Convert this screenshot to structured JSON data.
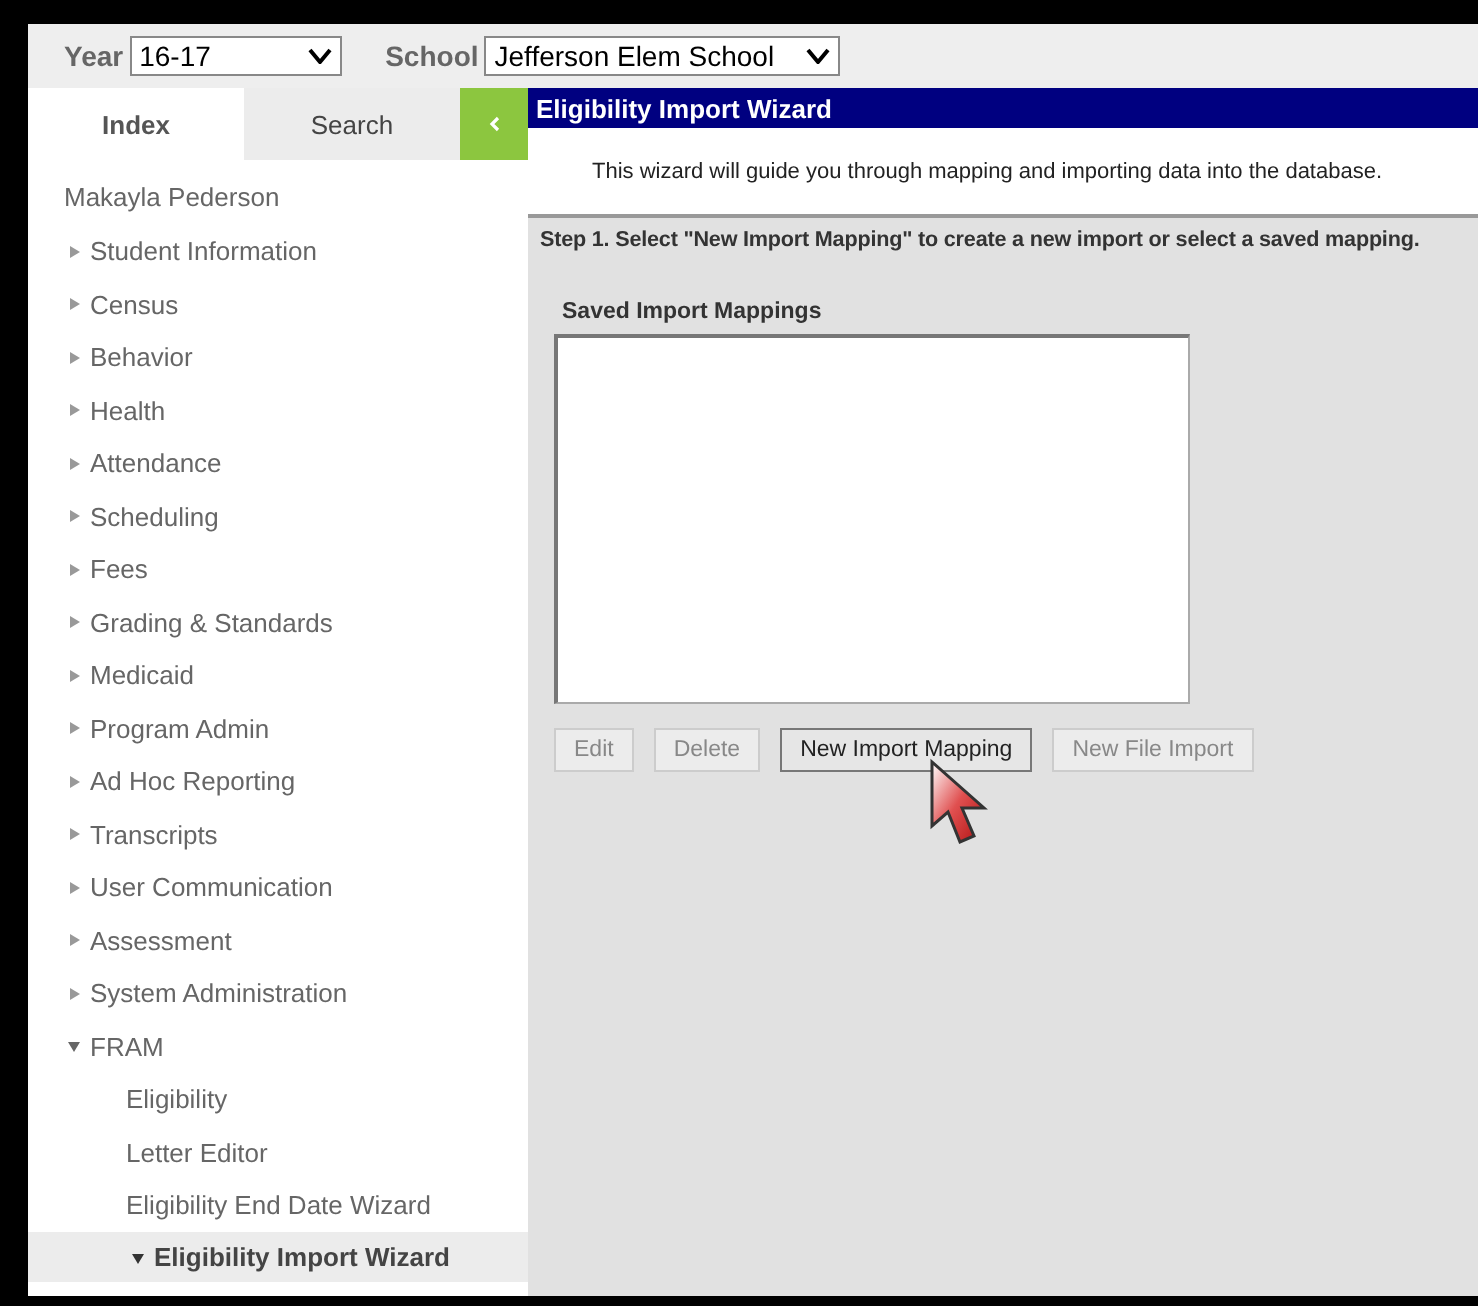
{
  "toolbar": {
    "year": {
      "label": "Year",
      "value": "16-17"
    },
    "school": {
      "label": "School",
      "value": "Jefferson Elem School"
    }
  },
  "tabs": [
    {
      "label": "Index",
      "selected": true
    },
    {
      "label": "Search",
      "selected": false
    }
  ],
  "sidebar": {
    "person": "Makayla Pederson",
    "items": [
      {
        "label": "Student Information",
        "kind": "folder",
        "expanded": false,
        "selected": false
      },
      {
        "label": "Census",
        "kind": "folder",
        "expanded": false,
        "selected": false
      },
      {
        "label": "Behavior",
        "kind": "folder",
        "expanded": false,
        "selected": false
      },
      {
        "label": "Health",
        "kind": "folder",
        "expanded": false,
        "selected": false
      },
      {
        "label": "Attendance",
        "kind": "folder",
        "expanded": false,
        "selected": false
      },
      {
        "label": "Scheduling",
        "kind": "folder",
        "expanded": false,
        "selected": false
      },
      {
        "label": "Fees",
        "kind": "folder",
        "expanded": false,
        "selected": false
      },
      {
        "label": "Grading & Standards",
        "kind": "folder",
        "expanded": false,
        "selected": false
      },
      {
        "label": "Medicaid",
        "kind": "folder",
        "expanded": false,
        "selected": false
      },
      {
        "label": "Program Admin",
        "kind": "folder",
        "expanded": false,
        "selected": false
      },
      {
        "label": "Ad Hoc Reporting",
        "kind": "folder",
        "expanded": false,
        "selected": false
      },
      {
        "label": "Transcripts",
        "kind": "folder",
        "expanded": false,
        "selected": false
      },
      {
        "label": "User Communication",
        "kind": "folder",
        "expanded": false,
        "selected": false
      },
      {
        "label": "Assessment",
        "kind": "folder",
        "expanded": false,
        "selected": false
      },
      {
        "label": "System Administration",
        "kind": "folder",
        "expanded": false,
        "selected": false
      },
      {
        "label": "FRAM",
        "kind": "folder",
        "expanded": true,
        "selected": false,
        "children": [
          {
            "label": "Eligibility",
            "kind": "leaf",
            "selected": false
          },
          {
            "label": "Letter Editor",
            "kind": "leaf",
            "selected": false
          },
          {
            "label": "Eligibility End Date Wizard",
            "kind": "leaf",
            "selected": false
          },
          {
            "label": "Eligibility Import Wizard",
            "kind": "folder",
            "expanded": true,
            "selected": true
          }
        ]
      }
    ]
  },
  "wizard": {
    "title": "Eligibility Import Wizard",
    "intro": "This wizard will guide you through mapping and importing data into the database.",
    "step": "Step 1. Select \"New Import Mapping\" to create a new import or select a saved mapping.",
    "list_label": "Saved Import Mappings",
    "buttons": [
      {
        "label": "Edit",
        "disabled": true
      },
      {
        "label": "Delete",
        "disabled": true
      },
      {
        "label": "New Import Mapping",
        "disabled": false
      },
      {
        "label": "New File Import",
        "disabled": true
      }
    ]
  }
}
